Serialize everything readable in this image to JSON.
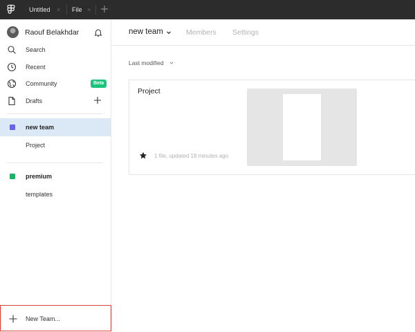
{
  "topbar": {
    "tabs": [
      {
        "label": "Untitled"
      },
      {
        "label": "File"
      }
    ]
  },
  "sidebar": {
    "user_name": "Raouf Belakhdar",
    "nav": [
      {
        "label": "Search",
        "icon": "search-icon"
      },
      {
        "label": "Recent",
        "icon": "clock-icon"
      },
      {
        "label": "Community",
        "icon": "globe-icon",
        "badge": "Beta"
      },
      {
        "label": "Drafts",
        "icon": "file-icon"
      }
    ],
    "teams": [
      {
        "label": "new team",
        "color": "#6b63e8",
        "active": true,
        "projects": [
          "Project"
        ]
      },
      {
        "label": "premium",
        "color": "#1bb36a",
        "active": false,
        "projects": [
          "templates"
        ]
      }
    ],
    "new_team_label": "New Team..."
  },
  "main": {
    "team_title": "new team",
    "tabs": [
      "Members",
      "Settings"
    ],
    "sort_label": "Last modified",
    "project": {
      "title": "Project",
      "meta": "1 file, updated 19 minutes ago"
    }
  },
  "colors": {
    "topbar": "#2c2c2c",
    "active_team_bg": "#dbe8f5",
    "beta_badge": "#1bc47d",
    "focus_outline": "#d9423b"
  }
}
